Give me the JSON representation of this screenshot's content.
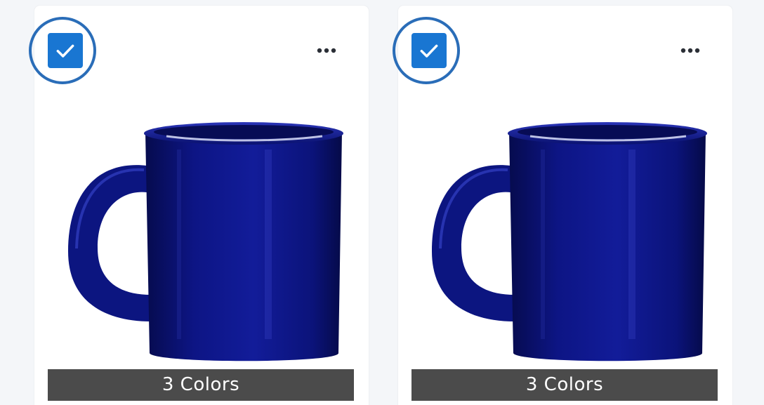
{
  "products": [
    {
      "selected": true,
      "colors_label": "3 Colors",
      "mug_color": "#0c1580"
    },
    {
      "selected": true,
      "colors_label": "3 Colors",
      "mug_color": "#0c1580"
    }
  ],
  "colors": {
    "page_background": "#f4f6f9",
    "card_background": "#ffffff",
    "accent": "#1976d2",
    "ring": "#2a6db8",
    "label_bar": "#4b4b4b",
    "label_text": "#ffffff"
  },
  "icons": {
    "checkbox": "check-icon",
    "menu": "more-horizontal-icon"
  }
}
